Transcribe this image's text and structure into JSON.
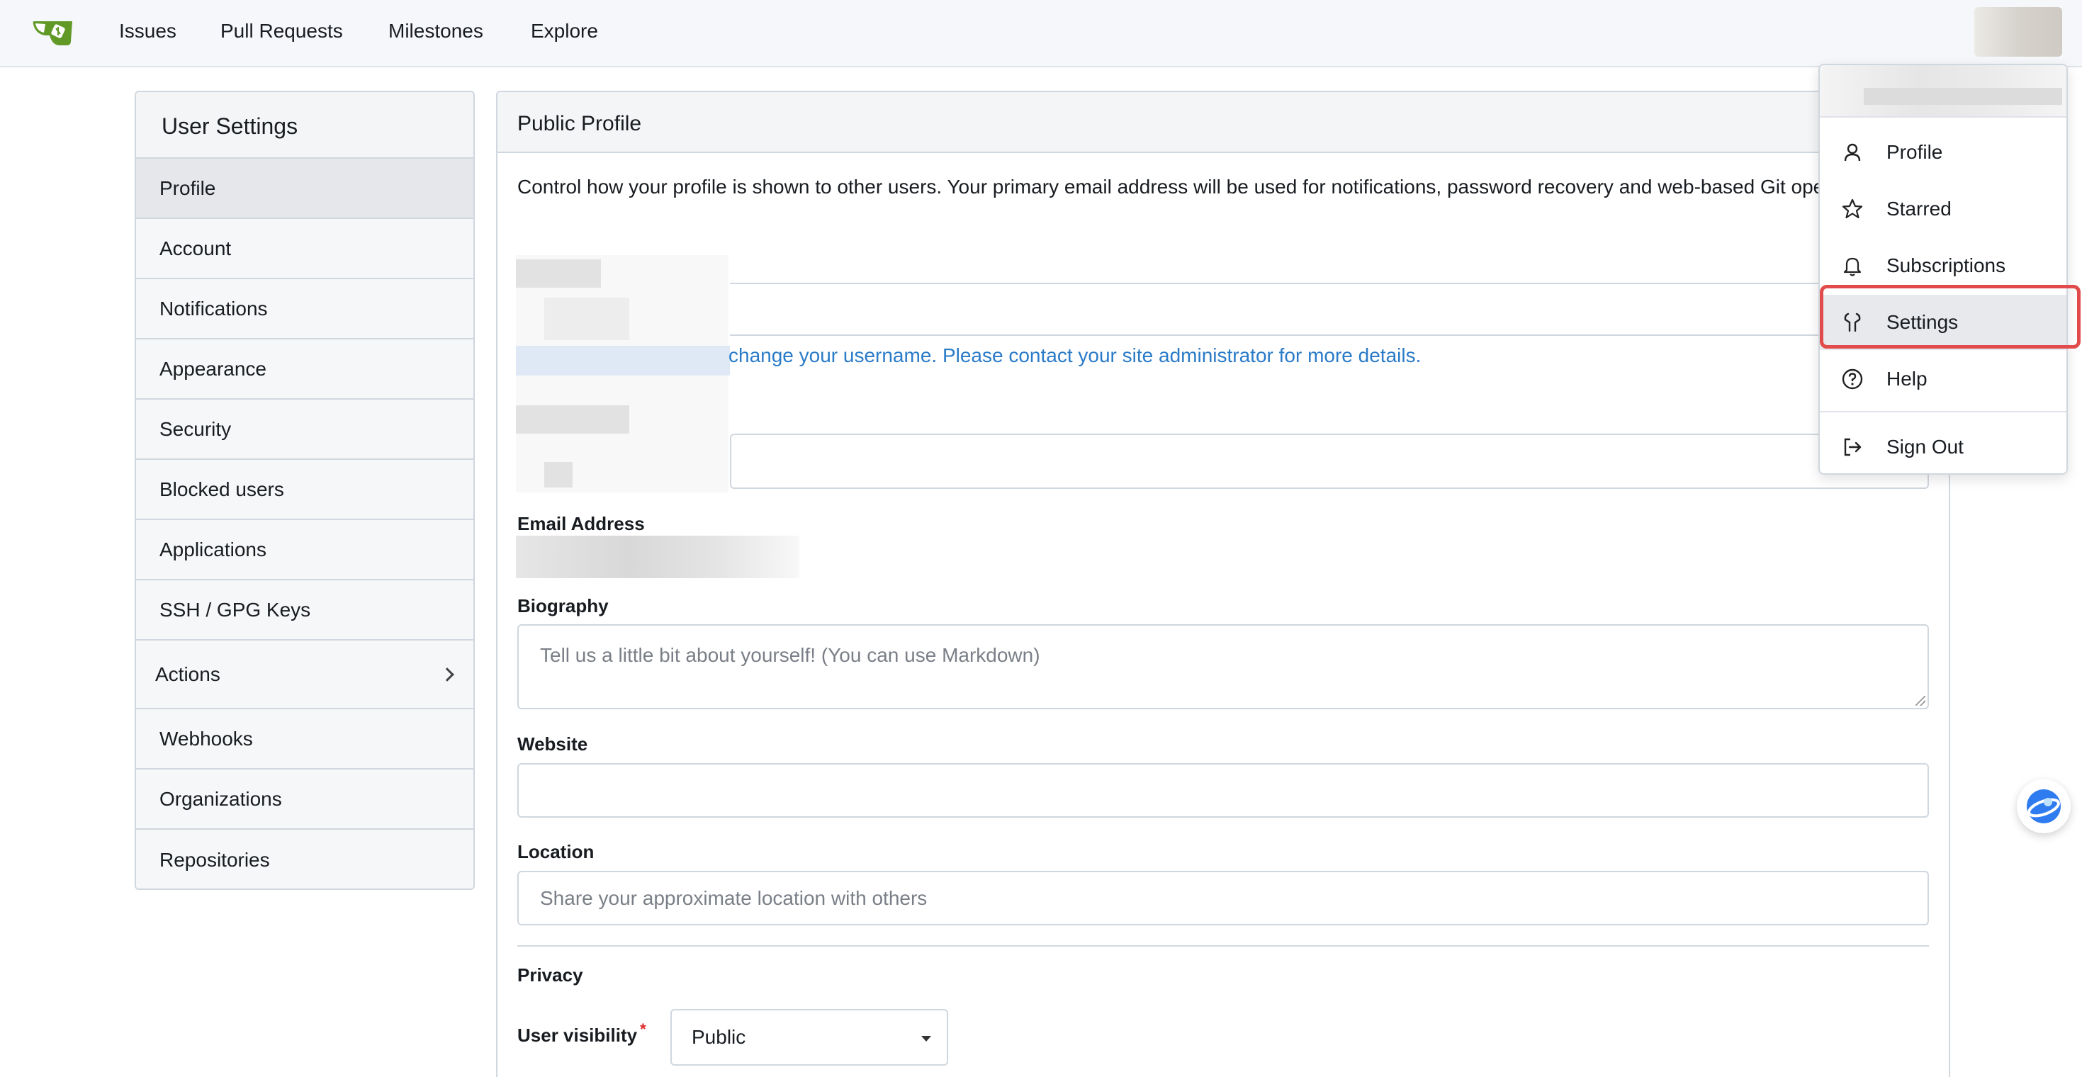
{
  "nav": {
    "items": [
      "Issues",
      "Pull Requests",
      "Milestones",
      "Explore"
    ]
  },
  "sidebar": {
    "title": "User Settings",
    "items": [
      {
        "label": "Profile"
      },
      {
        "label": "Account"
      },
      {
        "label": "Notifications"
      },
      {
        "label": "Appearance"
      },
      {
        "label": "Security"
      },
      {
        "label": "Blocked users"
      },
      {
        "label": "Applications"
      },
      {
        "label": "SSH / GPG Keys"
      },
      {
        "label": "Actions"
      },
      {
        "label": "Webhooks"
      },
      {
        "label": "Organizations"
      },
      {
        "label": "Repositories"
      }
    ]
  },
  "panel": {
    "title": "Public Profile",
    "description": "Control how your profile is shown to other users. Your primary email address will be used for notifications, password recovery and web-based Git operations.",
    "username_notice": "change your username. Please contact your site administrator for more details.",
    "email_label": "Email Address",
    "biography_label": "Biography",
    "biography_placeholder": "Tell us a little bit about yourself! (You can use Markdown)",
    "website_label": "Website",
    "website_value": "",
    "location_label": "Location",
    "location_placeholder": "Share your approximate location with others",
    "privacy_label": "Privacy",
    "visibility_label": "User visibility",
    "visibility_required": "*",
    "visibility_value": "Public"
  },
  "dropdown": {
    "items": [
      {
        "label": "Profile",
        "icon": "person-icon"
      },
      {
        "label": "Starred",
        "icon": "star-icon"
      },
      {
        "label": "Subscriptions",
        "icon": "bell-icon"
      },
      {
        "label": "Settings",
        "icon": "tools-icon"
      },
      {
        "label": "Help",
        "icon": "question-icon"
      },
      {
        "label": "Sign Out",
        "icon": "sign-out-icon"
      }
    ],
    "highlighted": "Settings"
  },
  "colors": {
    "accent": "#2a7bc8",
    "logo_green": "#609926",
    "highlight_border": "#e24b4b"
  }
}
